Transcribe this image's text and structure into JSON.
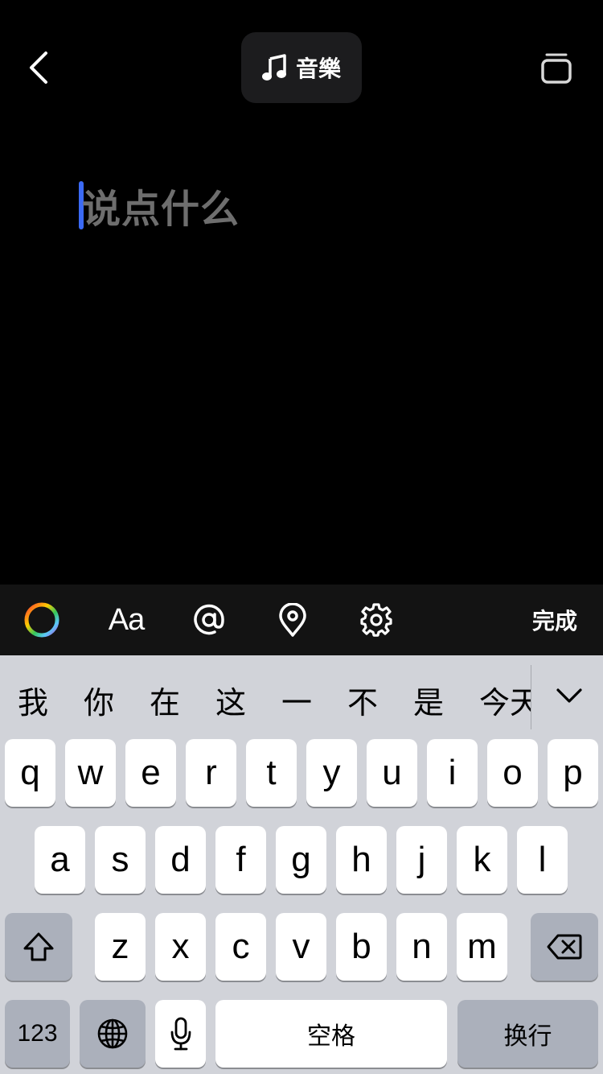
{
  "header": {
    "music_label": "音樂",
    "icons": {
      "back": "chevron-left-icon",
      "music": "music-note-icon",
      "stack": "stack-icon"
    }
  },
  "compose": {
    "placeholder": "说点什么"
  },
  "toolbar": {
    "font_label": "Aa",
    "done_label": "完成",
    "icons": [
      "color-wheel-icon",
      "at-icon",
      "location-pin-icon",
      "gear-icon"
    ]
  },
  "keyboard": {
    "candidates": [
      "我",
      "你",
      "在",
      "这",
      "一",
      "不",
      "是",
      "今天"
    ],
    "row1": [
      "q",
      "w",
      "e",
      "r",
      "t",
      "y",
      "u",
      "i",
      "o",
      "p"
    ],
    "row2": [
      "a",
      "s",
      "d",
      "f",
      "g",
      "h",
      "j",
      "k",
      "l"
    ],
    "row3": [
      "z",
      "x",
      "c",
      "v",
      "b",
      "n",
      "m"
    ],
    "numbers_label": "123",
    "space_label": "空格",
    "return_label": "换行",
    "icons": {
      "shift": "shift-icon",
      "delete": "delete-icon",
      "globe": "globe-icon",
      "mic": "microphone-icon",
      "collapse": "chevron-down-icon"
    }
  }
}
